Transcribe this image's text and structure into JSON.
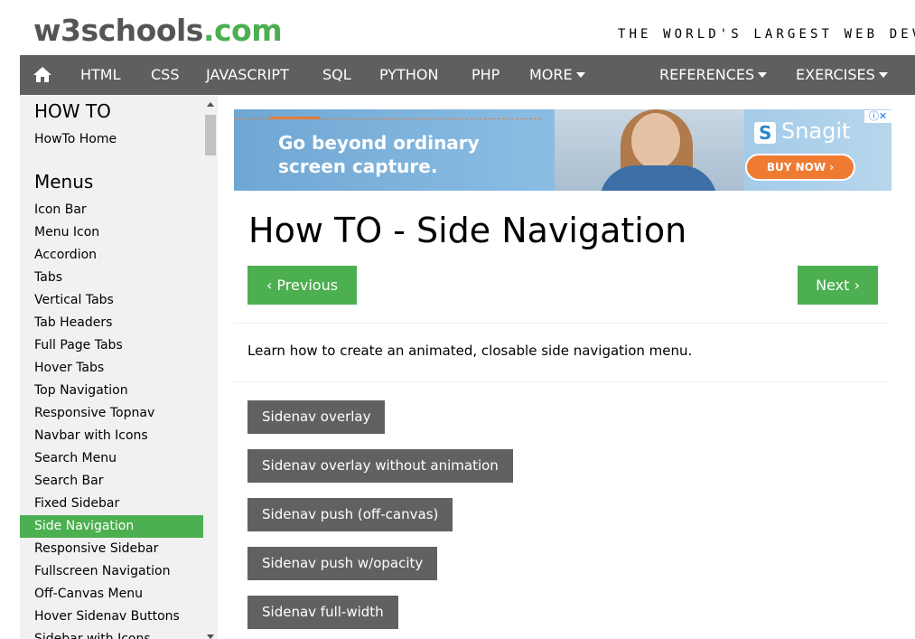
{
  "header": {
    "logo_main": "w3schools",
    "logo_suffix": ".com",
    "tagline": "THE WORLD'S LARGEST WEB DEV"
  },
  "navbar": {
    "home_icon": "home-icon",
    "items": [
      "HTML",
      "CSS",
      "JAVASCRIPT",
      "SQL",
      "PYTHON",
      "PHP",
      "MORE",
      "REFERENCES",
      "EXERCISES"
    ]
  },
  "sidebar": {
    "section1_title": "HOW TO",
    "home_link": "HowTo Home",
    "section2_title": "Menus",
    "items": [
      "Icon Bar",
      "Menu Icon",
      "Accordion",
      "Tabs",
      "Vertical Tabs",
      "Tab Headers",
      "Full Page Tabs",
      "Hover Tabs",
      "Top Navigation",
      "Responsive Topnav",
      "Navbar with Icons",
      "Search Menu",
      "Search Bar",
      "Fixed Sidebar",
      "Side Navigation",
      "Responsive Sidebar",
      "Fullscreen Navigation",
      "Off-Canvas Menu",
      "Hover Sidenav Buttons",
      "Sidebar with Icons"
    ],
    "active": "Side Navigation"
  },
  "ad": {
    "text": "Go beyond ordinary screen capture.",
    "brand": "Snagit",
    "button": "BUY NOW ›",
    "close": "ⓘ✕"
  },
  "main": {
    "title": "How TO - Side Navigation",
    "prev": "‹ Previous",
    "next": "Next ›",
    "intro": "Learn how to create an animated, closable side navigation menu.",
    "demo_buttons": [
      "Sidenav overlay",
      "Sidenav overlay without animation",
      "Sidenav push (off-canvas)",
      "Sidenav push w/opacity",
      "Sidenav full-width"
    ]
  },
  "colors": {
    "accent": "#4CAF50",
    "navbar": "#5f5f5f",
    "dark_button": "#616161",
    "sidebar_bg": "#f1f1f1"
  }
}
